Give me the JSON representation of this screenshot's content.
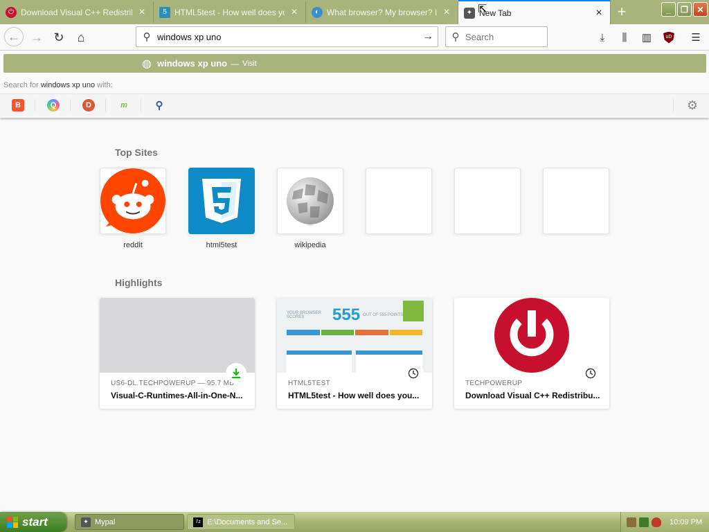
{
  "tabs": [
    {
      "title": "Download Visual C++ Redistribu",
      "icon": "power-icon",
      "active": false
    },
    {
      "title": "HTML5test - How well does your",
      "icon": "html5-icon",
      "active": false
    },
    {
      "title": "What browser? My browser? Is m",
      "icon": "globe-icon",
      "active": false
    },
    {
      "title": "New Tab",
      "icon": "mypal-icon",
      "active": true
    }
  ],
  "navbar": {
    "url_value": "windows xp uno",
    "search_placeholder": "Search"
  },
  "popup": {
    "suggestion_query": "windows xp uno",
    "suggestion_dash": "—",
    "suggestion_action": "Visit",
    "search_for_prefix": "Search for",
    "search_for_query": "windows xp uno",
    "search_for_suffix": "with:",
    "engines": [
      "brave-icon",
      "qwant-icon",
      "duckduckgo-icon",
      "mojeek-icon",
      "search-icon"
    ]
  },
  "content": {
    "top_sites_title": "Top Sites",
    "top_sites": [
      {
        "label": "reddit"
      },
      {
        "label": "html5test"
      },
      {
        "label": "wikipedia"
      },
      {
        "label": ""
      },
      {
        "label": ""
      },
      {
        "label": ""
      }
    ],
    "highlights_title": "Highlights",
    "highlights": [
      {
        "context": "US6-DL.TECHPOWERUP — 95.7 MB",
        "title": "Visual-C-Runtimes-All-in-One-N...",
        "badge": "download-icon"
      },
      {
        "context": "HTML5TEST",
        "title": "HTML5test - How well does you...",
        "badge": "clock-icon",
        "score": "555",
        "score_prefix": "YOUR BROWSER SCORES",
        "score_suffix": "OUT OF 555 POINTS"
      },
      {
        "context": "TECHPOWERUP",
        "title": "Download Visual C++ Redistribu...",
        "badge": "clock-icon"
      }
    ]
  },
  "taskbar": {
    "start_label": "start",
    "tasks": [
      {
        "label": "Mypal",
        "active": true
      },
      {
        "label": "E:\\Documents and Se...",
        "active": false
      }
    ],
    "clock": "10:09 PM"
  },
  "colors": {
    "accent": "#a8b47c",
    "reddit": "#ff4500",
    "html5": "#0e8ac7",
    "techpowerup": "#c8102e"
  }
}
